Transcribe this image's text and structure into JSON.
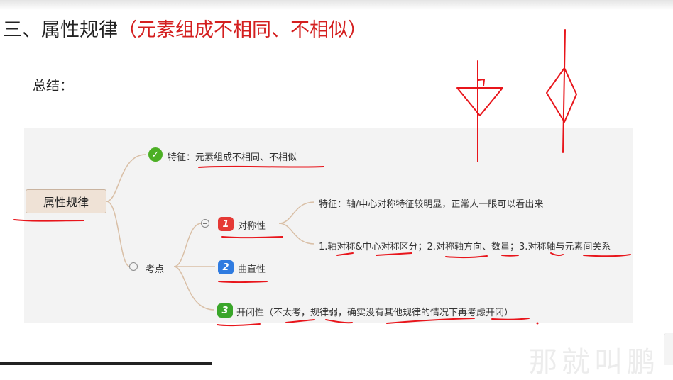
{
  "title": {
    "main": "三、属性规律",
    "highlight": "（元素组成不相同、不相似）"
  },
  "summary_label": "总结：",
  "mindmap": {
    "root": "属性规律",
    "feature": {
      "icon": "check-icon",
      "text": "特征：元素组成不相同、不相似"
    },
    "exam_points_label": "考点",
    "items": [
      {
        "number": "1",
        "label": "对称性",
        "color": "#e53935",
        "details": [
          "特征：轴/中心对称特征较明显，正常人一眼可以看出来",
          "1.轴对称&中心对称区分；2.对称轴方向、数量；3.对称轴与元素间关系"
        ]
      },
      {
        "number": "2",
        "label": "曲直性",
        "color": "#2f7be0"
      },
      {
        "number": "3",
        "label": "开闭性（不太考，规律弱，确实没有其他规律的情况下再考虑开闭）",
        "color": "#3aa62a"
      }
    ]
  },
  "watermark": "那就叫鹏",
  "colors": {
    "annotation_red": "#e8151b",
    "branch_line": "#d9bfa6",
    "root_fill": "#efe2d6",
    "panel_bg": "#f3f3f3"
  }
}
